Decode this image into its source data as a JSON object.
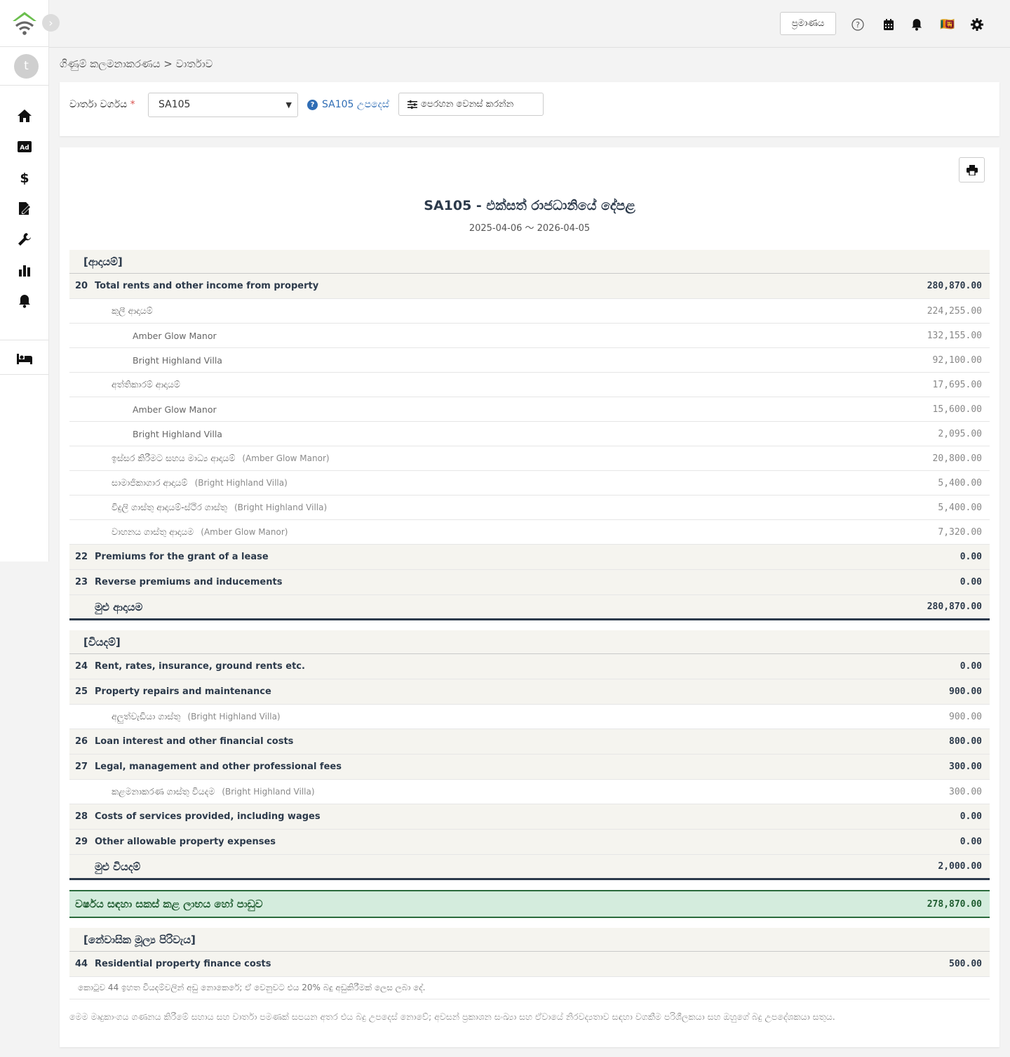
{
  "topbar": {
    "verify_label": "ප්‍රමාණය",
    "flag_emoji": "🇱🇰"
  },
  "sidebar": {
    "collapse_glyph": "›",
    "avatar_initial": "t"
  },
  "breadcrumb": "ගිණුම් කලමනාකරණය > වාර්තාව",
  "filter": {
    "label": "වාර්තා වර්ගය",
    "required_mark": "*",
    "selected": "SA105",
    "help_label": "SA105 උපදෙස්",
    "filter_button": "පෙරහන වෙනස් කරන්න"
  },
  "report": {
    "title": "SA105 - එක්සත් රාජධානියේ දේපළ",
    "dates": "2025-04-06 〜 2026-04-05",
    "income_header": "[ආදායම්]",
    "income_rows": [
      {
        "kind": "main",
        "code": "20",
        "label": "Total rents and other income from property",
        "amount": "280,870.00"
      },
      {
        "kind": "sub1",
        "label": "කුලී ආදායම්",
        "tag": "",
        "amount": "224,255.00"
      },
      {
        "kind": "sub2",
        "label": "Amber Glow Manor",
        "tag": "",
        "amount": "132,155.00"
      },
      {
        "kind": "sub2",
        "label": "Bright Highland Villa",
        "tag": "",
        "amount": "92,100.00"
      },
      {
        "kind": "sub1",
        "label": "අත්තිකාරම් ආදායම්",
        "tag": "",
        "amount": "17,695.00"
      },
      {
        "kind": "sub2",
        "label": "Amber Glow Manor",
        "tag": "",
        "amount": "15,600.00"
      },
      {
        "kind": "sub2",
        "label": "Bright Highland Villa",
        "tag": "",
        "amount": "2,095.00"
      },
      {
        "kind": "sub1",
        "label": "ඉස්සර කිරීමට සහය මාධ්‍ය ආදායම්",
        "tag": "(Amber Glow Manor)",
        "amount": "20,800.00"
      },
      {
        "kind": "sub1",
        "label": "සාමාජිකාගාර ආදායම්",
        "tag": "(Bright Highland Villa)",
        "amount": "5,400.00"
      },
      {
        "kind": "sub1",
        "label": "විදුලි ගාස්තු ආදායම්-ස්ථිර ගාස්තු",
        "tag": "(Bright Highland Villa)",
        "amount": "5,400.00"
      },
      {
        "kind": "sub1",
        "label": "වාහනය ගාස්තු ආදායම",
        "tag": "(Amber Glow Manor)",
        "amount": "7,320.00"
      },
      {
        "kind": "main",
        "code": "22",
        "label": "Premiums for the grant of a lease",
        "amount": "0.00"
      },
      {
        "kind": "main",
        "code": "23",
        "label": "Reverse premiums and inducements",
        "amount": "0.00"
      }
    ],
    "income_total_label": "මුළු ආදායම",
    "income_total": "280,870.00",
    "expense_header": "[වියදම්]",
    "expense_rows": [
      {
        "kind": "main",
        "code": "24",
        "label": "Rent, rates, insurance, ground rents etc.",
        "amount": "0.00"
      },
      {
        "kind": "main",
        "code": "25",
        "label": "Property repairs and maintenance",
        "amount": "900.00"
      },
      {
        "kind": "sub1",
        "label": "අලුත්වැඩියා ගාස්තු",
        "tag": "(Bright Highland Villa)",
        "amount": "900.00"
      },
      {
        "kind": "main",
        "code": "26",
        "label": "Loan interest and other financial costs",
        "amount": "800.00"
      },
      {
        "kind": "main",
        "code": "27",
        "label": "Legal, management and other professional fees",
        "amount": "300.00"
      },
      {
        "kind": "sub1",
        "label": "කළමනාකරණ ගාස්තු වියදම",
        "tag": "(Bright Highland Villa)",
        "amount": "300.00"
      },
      {
        "kind": "main",
        "code": "28",
        "label": "Costs of services provided, including wages",
        "amount": "0.00"
      },
      {
        "kind": "main",
        "code": "29",
        "label": "Other allowable property expenses",
        "amount": "0.00"
      }
    ],
    "expense_total_label": "මුළු වියදම්",
    "expense_total": "2,000.00",
    "net_label": "වර්ෂය සඳහා සකස් කළ ලාභය හෝ පාඩුව",
    "net_amount": "278,870.00",
    "relief_header": "[නේවාසික මූල්‍ය පිරිවැය]",
    "relief_code": "44",
    "relief_label": "Residential property finance costs",
    "relief_amount": "500.00",
    "relief_note": "කොටුව 44 ඉහත වියදම්වලින් අඩු නොකෙරේ; ඒ වෙනුවට එය 20% බදු අඩුකිරීමක් ලෙස ලබා දේ.",
    "disclaimer": "මෙම මෘදුකාංගය ගණනය කිරීමේ සහාය සහ වාර්තා පමණක් සපයන අතර එය බදු උපදෙස් නොවේ; අවසන් ප්‍රකාශන සංඛ්‍යා සහ ඒවායේ නිරවද්‍යතාව සඳහා වගකීම පරිශීලකයා සහ ඔහුගේ බදු උපදේශකයා සතුය."
  }
}
